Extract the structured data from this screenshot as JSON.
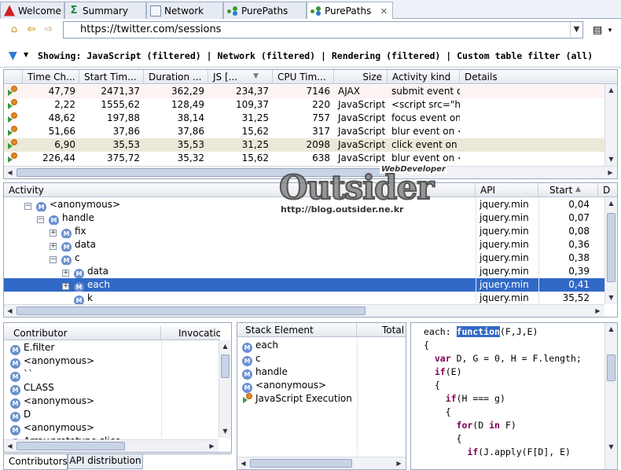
{
  "tabs": [
    {
      "label": "Welcome",
      "icon": "welcome-icon"
    },
    {
      "label": "Summary",
      "icon": "summary-icon"
    },
    {
      "label": "Network",
      "icon": "network-icon"
    },
    {
      "label": "PurePaths",
      "icon": "purepaths-icon"
    },
    {
      "label": "PurePaths",
      "icon": "purepaths-icon",
      "active": true
    }
  ],
  "address": {
    "url": "https://twitter.com/sessions"
  },
  "filter": {
    "text": "Showing: JavaScript (filtered) | Network (filtered) | Rendering (filtered) | Custom table filter (all)"
  },
  "purepaths": {
    "columns": [
      "Time Ch...",
      "Start Tim...",
      "Duration ...",
      "JS [...",
      "CPU Tim...",
      "Size",
      "Activity kind",
      "Details"
    ],
    "rows": [
      [
        "",
        "47,79",
        "2471,37",
        "362,29",
        "234,37",
        "7146",
        "AJAX",
        "submit event on <form id=\"status"
      ],
      [
        "",
        "2,22",
        "1555,62",
        "128,49",
        "109,37",
        "220",
        "JavaScript",
        "<script src=\"http://ajax.googleap"
      ],
      [
        "",
        "48,62",
        "197,88",
        "38,14",
        "31,25",
        "757",
        "JavaScript",
        "focus event on <textarea id=\"sta"
      ],
      [
        "",
        "51,66",
        "37,86",
        "37,86",
        "15,62",
        "317",
        "JavaScript",
        "blur event on <textarea id=\"statu"
      ],
      [
        "",
        "6,90",
        "35,53",
        "35,53",
        "31,25",
        "2098",
        "JavaScript",
        "click event on <textarea id=\"sta"
      ],
      [
        "",
        "226,44",
        "375,72",
        "35,32",
        "15,62",
        "638",
        "JavaScript",
        "blur event on <textarea id=\"statu"
      ]
    ]
  },
  "activity": {
    "columns": [
      "Activity",
      "API",
      "Start",
      "D"
    ],
    "rows": [
      {
        "label": "<anonymous>",
        "api": "jquery.min",
        "start": "0,04",
        "indent": 0,
        "toggle": "−"
      },
      {
        "label": "handle",
        "api": "jquery.min",
        "start": "0,07",
        "indent": 1,
        "toggle": "−"
      },
      {
        "label": "fix",
        "api": "jquery.min",
        "start": "0,08",
        "indent": 2,
        "toggle": "+"
      },
      {
        "label": "data",
        "api": "jquery.min",
        "start": "0,36",
        "indent": 2,
        "toggle": "+"
      },
      {
        "label": "c",
        "api": "jquery.min",
        "start": "0,38",
        "indent": 2,
        "toggle": "−"
      },
      {
        "label": "data",
        "api": "jquery.min",
        "start": "0,39",
        "indent": 3,
        "toggle": "+"
      },
      {
        "label": "each",
        "api": "jquery.min",
        "start": "0,41",
        "indent": 3,
        "toggle": "+",
        "selected": true
      },
      {
        "label": "k",
        "api": "jquery.min",
        "start": "35,52",
        "indent": 3,
        "toggle": ""
      }
    ]
  },
  "contributors": {
    "columns": [
      "Contributor",
      "Invocatio"
    ],
    "rows": [
      "E.filter",
      "<anonymous>",
      "``",
      "CLASS",
      "<anonymous>",
      "D",
      "<anonymous>",
      "Array.prototype.slice"
    ],
    "tabs": [
      "Contributors",
      "API distribution"
    ]
  },
  "stack": {
    "columns": [
      "Stack Element",
      "Total"
    ],
    "rows": [
      "each",
      "c",
      "handle",
      "<anonymous>",
      "JavaScript Execution"
    ]
  },
  "code": {
    "lines": [
      "each: function(F,J,E)",
      "{",
      "  var D, G = 0, H = F.length;",
      "  if(E)",
      "  {",
      "    if(H === g)",
      "    {",
      "      for(D in F)",
      "      {",
      "        if(J.apply(F[D], E)"
    ]
  },
  "watermark": {
    "title": "Outsider",
    "subtitle": "http://blog.outsider.ne.kr",
    "tag": "WebDeveloper"
  }
}
